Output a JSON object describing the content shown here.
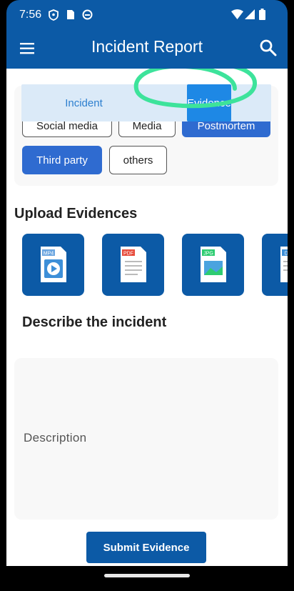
{
  "status_bar": {
    "time": "7:56",
    "icons": [
      "vpn-shield-icon",
      "sim-card-icon",
      "data-saver-icon",
      "wifi-icon",
      "signal-icon",
      "battery-icon"
    ]
  },
  "app_bar": {
    "title": "Incident Report",
    "menu_icon": "hamburger-menu-icon",
    "search_icon": "search-icon"
  },
  "tabs": [
    {
      "label": "Incident",
      "selected": false
    },
    {
      "label": "Evidence",
      "selected": true
    }
  ],
  "source_chips": [
    {
      "label": "Social media",
      "selected": false
    },
    {
      "label": "Media",
      "selected": false
    },
    {
      "label": "Postmortem",
      "selected": true
    },
    {
      "label": "Third party",
      "selected": true
    },
    {
      "label": "others",
      "selected": false
    }
  ],
  "upload": {
    "title": "Upload Evidences",
    "file_types": [
      {
        "label": "MP4",
        "icon": "video-file-icon"
      },
      {
        "label": "PDF",
        "icon": "pdf-file-icon"
      },
      {
        "label": "JPG",
        "icon": "image-file-icon"
      },
      {
        "label": "DO",
        "icon": "doc-file-icon"
      }
    ]
  },
  "describe": {
    "title": "Describe the incident",
    "placeholder": "Description"
  },
  "submit_label": "Submit Evidence",
  "colors": {
    "primary": "#0c5aa6",
    "chip_selected": "#2f6bd0",
    "tab_bg": "#dbeaf8",
    "tab_selected": "#1e88e5",
    "annotation": "#3de39b"
  }
}
